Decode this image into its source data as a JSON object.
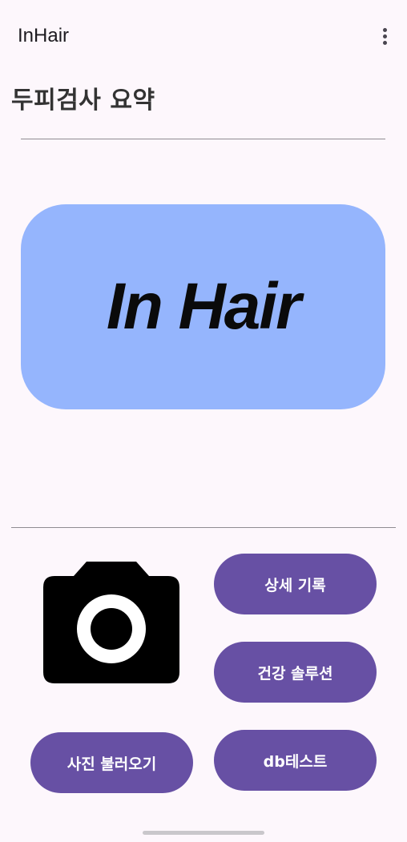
{
  "app_bar": {
    "title": "InHair",
    "menu_icon": "more-vert-icon"
  },
  "page": {
    "title": "두피검사 요약"
  },
  "banner": {
    "logo_text": "In Hair",
    "background_color": "#95b5fd"
  },
  "actions": {
    "camera_icon": "camera-icon",
    "detail_record_label": "상세 기록",
    "health_solution_label": "건강 솔루션",
    "db_test_label": "db테스트",
    "load_photo_label": "사진 불러오기"
  },
  "colors": {
    "accent": "#6750a4",
    "background": "#fdf7fc",
    "divider": "#8f8c92"
  }
}
